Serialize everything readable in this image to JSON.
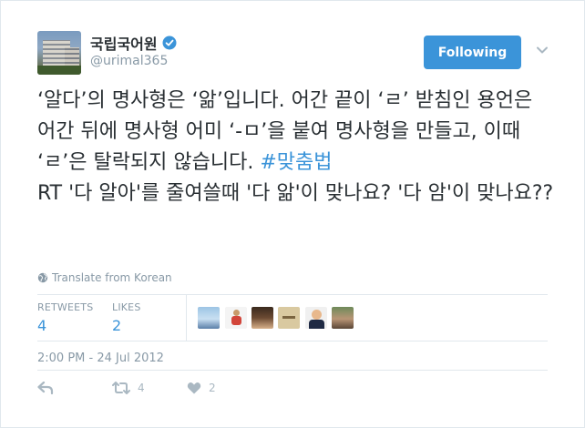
{
  "profile": {
    "display_name": "국립국어원",
    "handle": "@urimal365",
    "verified": true
  },
  "follow_button": {
    "label": "Following"
  },
  "tweet": {
    "text_main": "‘알다’의 명사형은 ‘앎’입니다. 어간 끝이 ‘ㄹ’ 받침인 용언은 어간 뒤에 명사형 어미 ‘-ㅁ’을 붙여 명사형을 만들고, 이때 ‘ㄹ’은 탈락되지 않습니다. ",
    "hashtag": "#맞춤법",
    "text_rt": "RT '다 알아'를 줄여쓸때 '다 앎'이 맞나요? '다 암'이 맞나요??"
  },
  "translate": {
    "label": "Translate from Korean"
  },
  "stats": {
    "retweets_label": "RETWEETS",
    "retweets_value": "4",
    "likes_label": "LIKES",
    "likes_value": "2"
  },
  "timestamp": "2:00 PM - 24 Jul 2012",
  "actions": {
    "retweet_count": "4",
    "like_count": "2"
  },
  "colors": {
    "accent": "#3b94d9",
    "text": "#292f33",
    "muted": "#8899a6",
    "border": "#e1e8ed"
  }
}
